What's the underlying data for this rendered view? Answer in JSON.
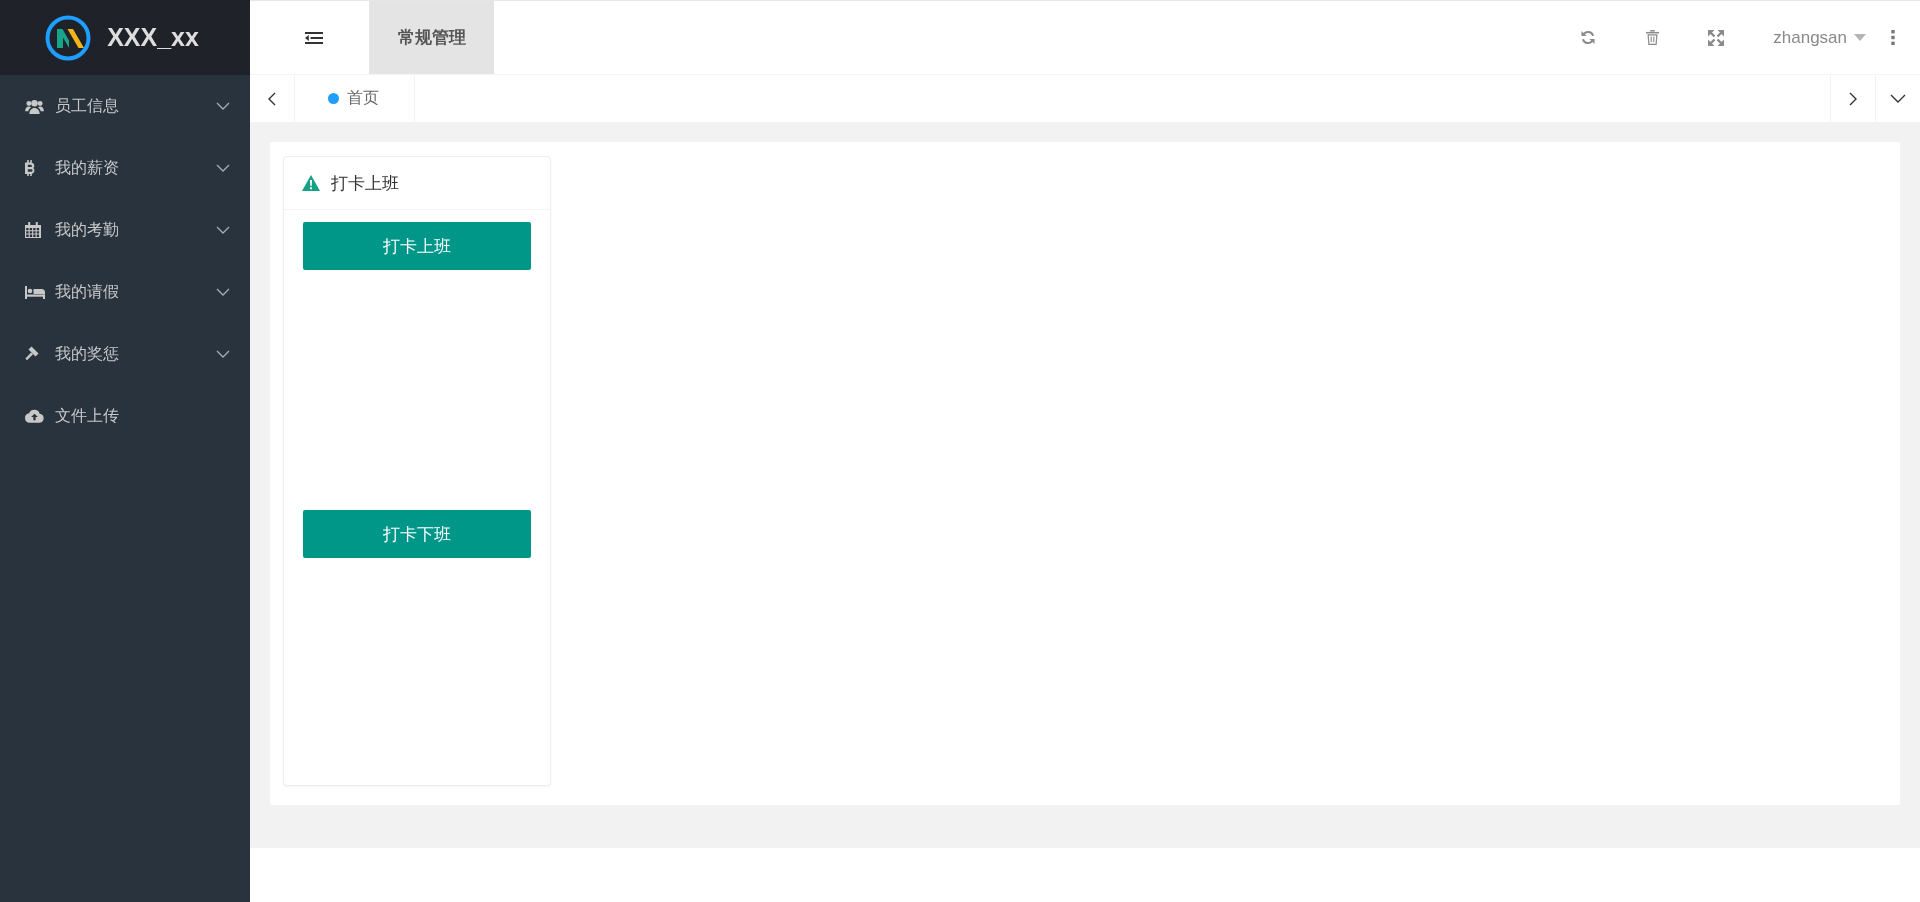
{
  "logo": {
    "text": "XXX_xx"
  },
  "sidebar": {
    "items": [
      {
        "label": "员工信息",
        "has_submenu": true,
        "selected": false
      },
      {
        "label": "我的薪资",
        "has_submenu": true,
        "selected": false
      },
      {
        "label": "我的考勤",
        "has_submenu": true,
        "selected": false
      },
      {
        "label": "我的请假",
        "has_submenu": true,
        "selected": false
      },
      {
        "label": "我的奖惩",
        "has_submenu": true,
        "selected": false
      },
      {
        "label": "文件上传",
        "has_submenu": false,
        "selected": false
      }
    ]
  },
  "header": {
    "tabs": [
      {
        "label": "常规管理",
        "selected": true
      }
    ],
    "user": {
      "name": "zhangsan"
    }
  },
  "page_tabs": [
    {
      "label": "首页",
      "selected": true
    }
  ],
  "card": {
    "title": "打卡上班",
    "buttons": [
      {
        "label": "打卡上班"
      },
      {
        "label": "打卡下班"
      }
    ]
  }
}
